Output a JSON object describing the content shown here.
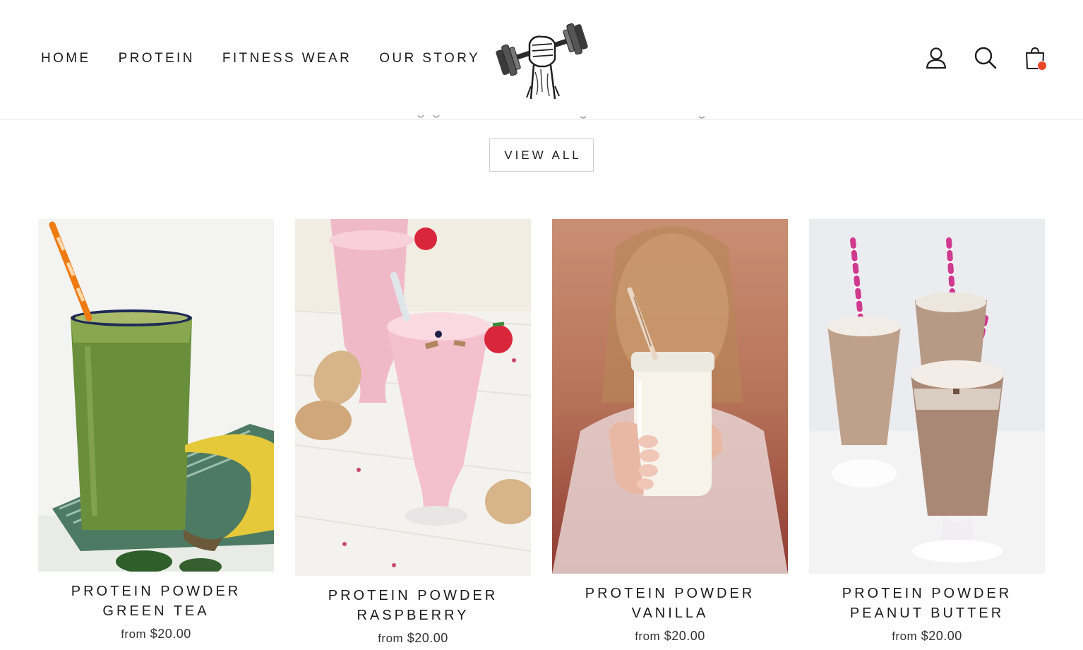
{
  "nav": {
    "items": [
      "HOME",
      "PROTEIN",
      "FITNESS WEAR",
      "OUR STORY"
    ]
  },
  "header_icons": [
    "account-icon",
    "search-icon",
    "cart-icon"
  ],
  "colors": {
    "cart_badge": "#e8472a",
    "text": "#1c1c1c",
    "border": "#cfcfcf"
  },
  "view_all_label": "VIEW ALL",
  "products": [
    {
      "title": "PROTEIN POWDER GREEN TEA",
      "from": "from",
      "price": "$20.00"
    },
    {
      "title": "PROTEIN POWDER RASPBERRY",
      "from": "from",
      "price": "$20.00"
    },
    {
      "title": "PROTEIN POWDER VANILLA",
      "from": "from",
      "price": "$20.00"
    },
    {
      "title": "PROTEIN POWDER PEANUT BUTTER",
      "from": "from",
      "price": "$20.00"
    }
  ]
}
